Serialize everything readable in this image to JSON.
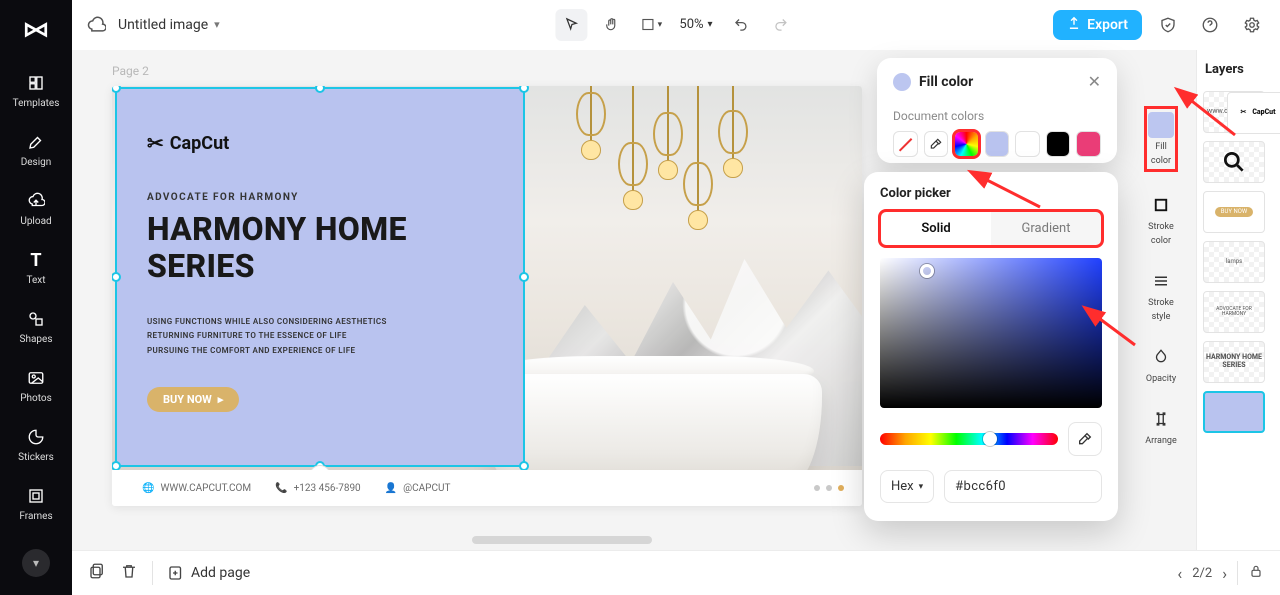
{
  "doc": {
    "title": "Untitled image"
  },
  "topbar": {
    "zoom": "50%",
    "export_label": "Export"
  },
  "sidenav": {
    "templates": "Templates",
    "design": "Design",
    "upload": "Upload",
    "text": "Text",
    "shapes": "Shapes",
    "photos": "Photos",
    "stickers": "Stickers",
    "frames": "Frames"
  },
  "canvas": {
    "page_label": "Page 2",
    "brand": "CapCut",
    "kicker": "ADVOCATE FOR HARMONY",
    "headline_l1": "HARMONY HOME",
    "headline_l2": "SERIES",
    "blurb_l1": "USING FUNCTIONS WHILE ALSO CONSIDERING AESTHETICS",
    "blurb_l2": "RETURNING FURNITURE TO THE ESSENCE OF LIFE",
    "blurb_l3": "PURSUING THE COMFORT AND EXPERIENCE OF LIFE",
    "cta": "BUY NOW",
    "footer": {
      "site": "WWW.CAPCUT.COM",
      "phone": "+123 456-7890",
      "handle": "@CAPCUT"
    }
  },
  "right_tools": {
    "fill_l1": "Fill",
    "fill_l2": "color",
    "stroke_l1": "Stroke",
    "stroke_l2": "color",
    "style_l1": "Stroke",
    "style_l2": "style",
    "opacity": "Opacity",
    "arrange": "Arrange"
  },
  "layers": {
    "title": "Layers",
    "thumbs": {
      "site": "www.capcut.com",
      "cta": "BUY NOW",
      "brand": "CapCut",
      "kicker": "ADVOCATE FOR HARMONY",
      "headline": "HARMONY HOME SERIES"
    }
  },
  "popover": {
    "title": "Fill color",
    "doc_colors_label": "Document colors"
  },
  "picker": {
    "title": "Color picker",
    "tab_solid": "Solid",
    "tab_gradient": "Gradient",
    "mode_label": "Hex",
    "hex": "#bcc6f0"
  },
  "bottom": {
    "add_page": "Add page",
    "page_indicator": "2/2"
  }
}
